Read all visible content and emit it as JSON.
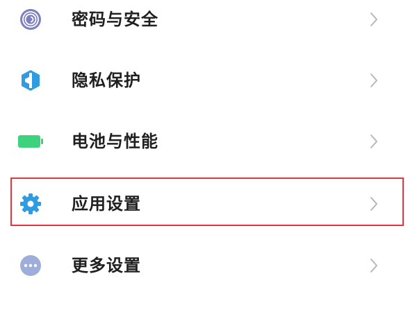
{
  "settings": {
    "items": [
      {
        "label": "密码与安全",
        "icon": "fingerprint-icon",
        "icon_color": "#7d7fbf"
      },
      {
        "label": "隐私保护",
        "icon": "shield-icon",
        "icon_color": "#2f9be0"
      },
      {
        "label": "电池与性能",
        "icon": "battery-icon",
        "icon_color": "#3ed17e"
      },
      {
        "label": "应用设置",
        "icon": "gear-icon",
        "icon_color": "#2f9be0"
      },
      {
        "label": "更多设置",
        "icon": "more-dots-icon",
        "icon_color": "#9eaedb"
      }
    ],
    "highlight_color": "#e5353b"
  }
}
